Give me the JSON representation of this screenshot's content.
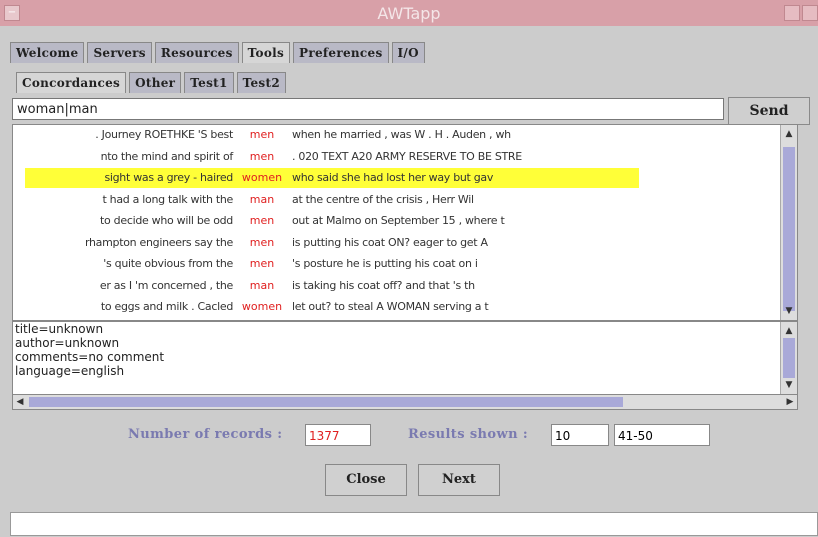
{
  "window": {
    "title": "AWTapp"
  },
  "main_tabs": [
    "Welcome",
    "Servers",
    "Resources",
    "Tools",
    "Preferences",
    "I/O"
  ],
  "sub_tabs": [
    "Concordances",
    "Other",
    "Test1",
    "Test2"
  ],
  "query": {
    "value": "woman|man",
    "send_label": "Send"
  },
  "concordance_rows": [
    {
      "left": ". Journey ROETHKE 'S best",
      "keyword": "men",
      "right": "when he married , was W . H . Auden , wh"
    },
    {
      "left": "nto the mind and spirit of",
      "keyword": "men",
      "right": ". 020 TEXT A20 ARMY RESERVE TO BE STRE"
    },
    {
      "left": "sight was a grey - haired",
      "keyword": "women",
      "right": "who said she had lost her way but gav"
    },
    {
      "left": "t had a long talk with the",
      "keyword": "man",
      "right": "at the centre of the crisis , Herr Wil"
    },
    {
      "left": "to decide who will be odd",
      "keyword": "men",
      "right": "out at Malmo on September 15 , where t"
    },
    {
      "left": "rhampton engineers say the",
      "keyword": "men",
      "right": "is putting his coat ON? eager to get A"
    },
    {
      "left": "'s quite obvious from the",
      "keyword": "men",
      "right": "'s posture he is putting his coat on i"
    },
    {
      "left": "er as I 'm concerned , the",
      "keyword": "man",
      "right": "is taking his coat off? and that 's th"
    },
    {
      "left": "to eggs and milk . Cacled",
      "keyword": "women",
      "right": "let out? to steal A WOMAN serving a t"
    }
  ],
  "highlighted_row": 2,
  "metadata_lines": [
    "title=unknown",
    "author=unknown",
    "comments=no comment",
    "language=english"
  ],
  "stats": {
    "records_label": "Number of records :",
    "records_value": "1377",
    "shown_label": "Results shown :",
    "shown_value": "10",
    "range_value": "41-50"
  },
  "buttons": {
    "close": "Close",
    "next": "Next"
  },
  "colors": {
    "titlebar": "#d8a0a8",
    "tab_bg": "#b9b9c6",
    "highlight": "#ffff38",
    "keyword": "#e02020",
    "scroll_thumb": "#a9a9d8",
    "stats_label": "#7a7ab0"
  }
}
